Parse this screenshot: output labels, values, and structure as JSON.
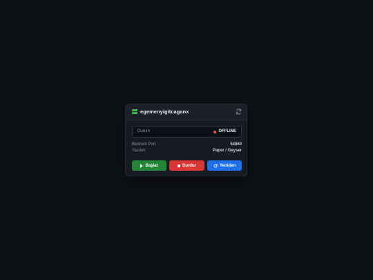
{
  "server": {
    "name": "egemenyigitcaganx",
    "icon": "server-icon",
    "refresh_icon": "refresh-icon"
  },
  "status": {
    "label": "Durum",
    "value": "OFFLINE",
    "color": "#f85149"
  },
  "info": [
    {
      "key": "Bedrock Port",
      "value": "54860"
    },
    {
      "key": "Yazılım",
      "value": "Paper / Geyser"
    }
  ],
  "buttons": {
    "start": {
      "label": "Başlat",
      "icon": "play-icon",
      "color": "#238636"
    },
    "stop": {
      "label": "Durdur",
      "icon": "stop-icon",
      "color": "#da3633"
    },
    "restart": {
      "label": "Yeniden",
      "icon": "refresh-icon",
      "color": "#1f6feb"
    }
  },
  "colors": {
    "background": "#0e1116",
    "card": "#161b22",
    "accent": "#3fb950"
  }
}
